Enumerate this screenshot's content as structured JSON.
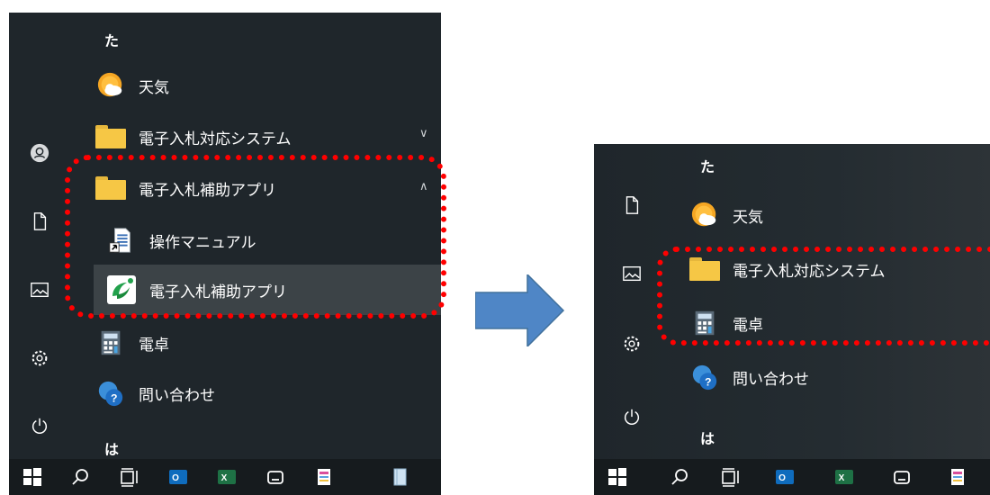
{
  "left": {
    "section_ta": "た",
    "weather_label": "天気",
    "folder_system_label": "電子入札対応システム",
    "folder_helper_label": "電子入札補助アプリ",
    "manual_label": "操作マニュアル",
    "helper_app_label": "電子入札補助アプリ",
    "calculator_label": "電卓",
    "contact_label": "問い合わせ",
    "section_ha": "は"
  },
  "right": {
    "section_ta": "た",
    "weather_label": "天気",
    "folder_system_label": "電子入札対応システム",
    "calculator_label": "電卓",
    "contact_label": "問い合わせ",
    "section_ha": "は"
  },
  "taskbar": {
    "outlook_badge": "O",
    "excel_badge": "X"
  },
  "colors": {
    "panel_bg": "#1f262b",
    "folder": "#f6c745",
    "highlight_box": "#ff0000",
    "arrow_fill": "#4f86c6",
    "arrow_stroke": "#41719c"
  },
  "icons": [
    "start-icon",
    "search-icon",
    "task-view-icon",
    "outlook-icon",
    "excel-icon",
    "store-icon",
    "notepad-icon",
    "tablet-icon",
    "user-icon",
    "document-icon",
    "pictures-icon",
    "settings-icon",
    "power-icon",
    "weather-icon",
    "folder-icon",
    "calculator-icon",
    "help-icon",
    "chevron-down-icon",
    "chevron-up-icon"
  ]
}
